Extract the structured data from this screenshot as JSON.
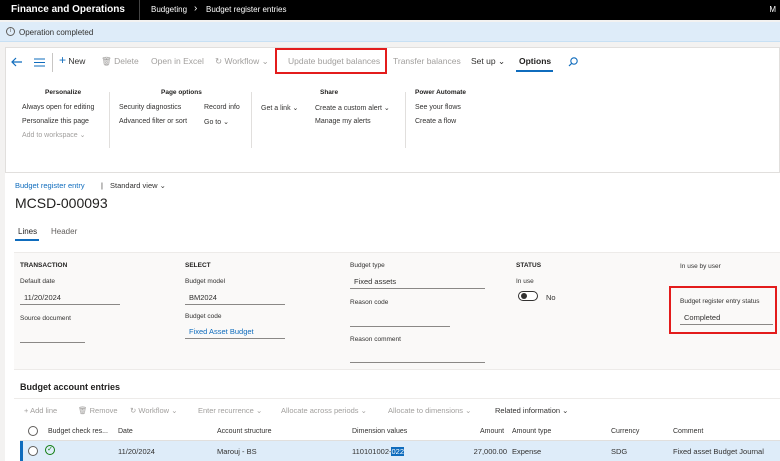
{
  "topbar": {
    "app_title": "Finance and Operations",
    "breadcrumb_1": "Budgeting",
    "breadcrumb_2": "Budget register entries",
    "right_glyph": "M"
  },
  "message": {
    "text": "Operation completed",
    "icon": "info-icon"
  },
  "toolbar": {
    "new": "New",
    "delete": "Delete",
    "open_in_excel": "Open in Excel",
    "workflow": "Workflow",
    "update_budget_balances": "Update budget balances",
    "transfer_balances": "Transfer balances",
    "set_up": "Set up",
    "options": "Options"
  },
  "ribbon": {
    "personalize": {
      "header": "Personalize",
      "items": [
        "Always open for editing",
        "Personalize this page",
        "Add to workspace"
      ]
    },
    "page_options": {
      "header": "Page options",
      "col1": [
        "Security diagnostics",
        "Advanced filter or sort"
      ],
      "col2": [
        "Record info",
        "Go to"
      ]
    },
    "share": {
      "header": "Share",
      "col1": [
        "Get a link"
      ],
      "col2": [
        "Create a custom alert",
        "Manage my alerts"
      ]
    },
    "power_automate": {
      "header": "Power Automate",
      "items": [
        "See your flows",
        "Create a flow"
      ]
    }
  },
  "form": {
    "breadcrumb_link": "Budget register entry",
    "view_separator": "|",
    "view": "Standard view",
    "record_id": "MCSD-000093",
    "tabs": [
      "Lines",
      "Header"
    ]
  },
  "header_fields": {
    "transaction": {
      "title": "TRANSACTION",
      "default_date_label": "Default date",
      "default_date": "11/20/2024",
      "source_document_label": "Source document"
    },
    "select": {
      "title": "SELECT",
      "budget_model_label": "Budget model",
      "budget_model": "BM2024",
      "budget_code_label": "Budget code",
      "budget_code": "Fixed Asset Budget"
    },
    "budget_type": {
      "label": "Budget type",
      "value": "Fixed assets",
      "reason_code_label": "Reason code",
      "reason_comment_label": "Reason comment"
    },
    "status": {
      "title": "STATUS",
      "in_use_label": "In use",
      "in_use_value": "No"
    },
    "in_use_by": {
      "label": "In use by user",
      "entry_status_label": "Budget register entry status",
      "entry_status": "Completed"
    }
  },
  "account_entries": {
    "title": "Budget account entries",
    "toolbar": [
      "Add line",
      "Remove",
      "Workflow",
      "Enter recurrence",
      "Allocate across periods",
      "Allocate to dimensions",
      "Related information"
    ],
    "columns": [
      "Budget check res...",
      "Date",
      "Account structure",
      "Dimension values",
      "Amount",
      "Amount type",
      "Currency",
      "Comment"
    ],
    "row": {
      "date": "11/20/2024",
      "account_structure": "Marouj - BS",
      "dimension_prefix": "110101002-",
      "dimension_selected": "022",
      "amount": "27,000.00",
      "amount_type": "Expense",
      "currency": "SDG",
      "comment": "Fixed asset Budget Journal"
    }
  }
}
